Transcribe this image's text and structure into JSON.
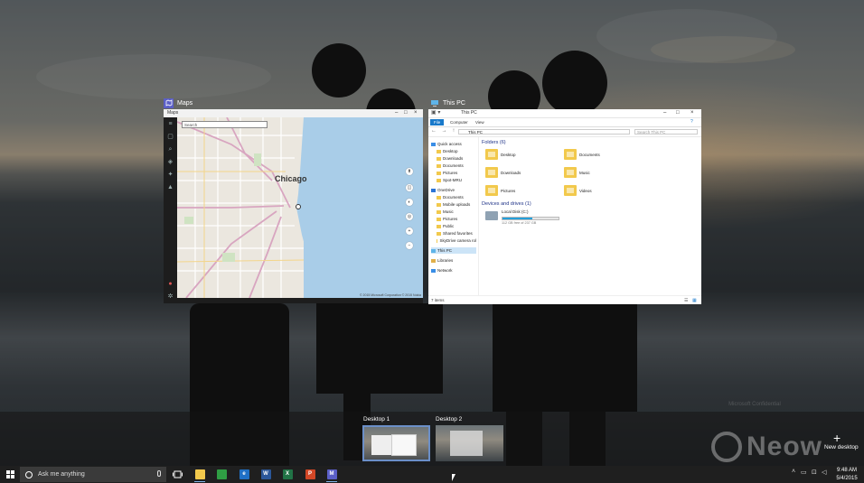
{
  "maps_window": {
    "title": "Maps",
    "app_label": "Maps",
    "search_placeholder": "Search",
    "city": "Chicago",
    "copyright": "© 2015 Microsoft Corporation  © 2015 Nokia"
  },
  "explorer_window": {
    "title": "This PC",
    "window_label": "This PC",
    "ribbon_tabs": [
      "File",
      "Computer",
      "View"
    ],
    "address": "This PC",
    "search_placeholder": "Search This PC",
    "nav": [
      {
        "label": "Quick access",
        "level": 0
      },
      {
        "label": "Desktop",
        "level": 1
      },
      {
        "label": "Downloads",
        "level": 1
      },
      {
        "label": "Documents",
        "level": 1
      },
      {
        "label": "Pictures",
        "level": 1
      },
      {
        "label": "Spot-MRU",
        "level": 1
      },
      {
        "label": "OneDrive",
        "level": 0
      },
      {
        "label": "Documents",
        "level": 1
      },
      {
        "label": "Mobile uploads",
        "level": 1
      },
      {
        "label": "Music",
        "level": 1
      },
      {
        "label": "Pictures",
        "level": 1
      },
      {
        "label": "Public",
        "level": 1
      },
      {
        "label": "Shared favorites",
        "level": 1
      },
      {
        "label": "SkyDrive camera rol",
        "level": 1
      },
      {
        "label": "This PC",
        "level": 0
      },
      {
        "label": "Libraries",
        "level": 0
      },
      {
        "label": "Network",
        "level": 0
      }
    ],
    "folders_header": "Folders (6)",
    "folders": [
      "Desktop",
      "Documents",
      "Downloads",
      "Music",
      "Pictures",
      "Videos"
    ],
    "devices_header": "Devices and drives (1)",
    "drive": {
      "name": "Local Disk (C:)",
      "free_text": "112 GB free of 237 GB",
      "used_fraction": 0.53
    },
    "status": "7 items"
  },
  "task_view": {
    "desktops": [
      {
        "label": "Desktop 1",
        "active": true
      },
      {
        "label": "Desktop 2",
        "active": false
      }
    ],
    "new_desktop_label": "New desktop"
  },
  "watermark": {
    "heading": "Microsoft Confidential",
    "brand": "Neow"
  },
  "taskbar": {
    "search_placeholder": "Ask me anything",
    "pinned": [
      {
        "name": "file-explorer",
        "color": "#f2c94c",
        "glyph": ""
      },
      {
        "name": "store",
        "color": "#2f9e44",
        "glyph": ""
      },
      {
        "name": "browser",
        "color": "#1f6fc5",
        "glyph": "e"
      },
      {
        "name": "word",
        "color": "#2b579a",
        "glyph": "W"
      },
      {
        "name": "excel",
        "color": "#217346",
        "glyph": "X"
      },
      {
        "name": "powerpoint",
        "color": "#d24726",
        "glyph": "P"
      },
      {
        "name": "maps",
        "color": "#5b5fc7",
        "glyph": "M"
      }
    ],
    "time": "9:48 AM",
    "date": "5/4/2015"
  }
}
